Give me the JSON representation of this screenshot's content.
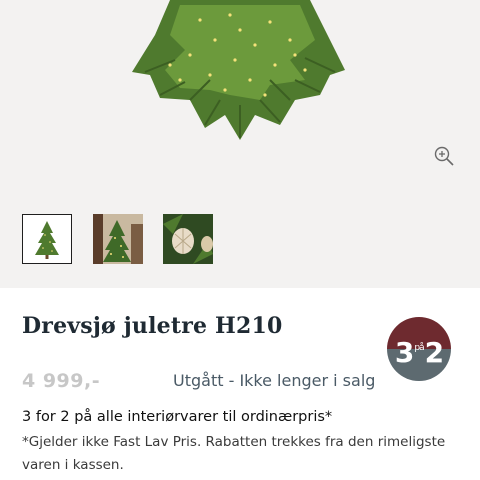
{
  "product": {
    "title": "Drevsjø juletre H210",
    "price": "4 999,-",
    "availability": "Utgått - Ikke lenger i salg"
  },
  "badge": {
    "text_left": "3",
    "text_super": "på",
    "text_right": "2",
    "color_top": "#6e2a2f",
    "color_bottom": "#5d6a70"
  },
  "offer": {
    "title": "3 for 2 på alle interiørvarer til ordinærpris*",
    "note": "*Gjelder ikke Fast Lav Pris. Rabatten trekkes fra den rimeligste varen i kassen."
  },
  "gallery": {
    "thumbnails": [
      {
        "name": "christmas-tree-thumbnail",
        "selected": true
      },
      {
        "name": "tree-in-room-thumbnail",
        "selected": false
      },
      {
        "name": "ornament-closeup-thumbnail",
        "selected": false
      }
    ],
    "zoom_icon": "zoom-in-icon"
  }
}
